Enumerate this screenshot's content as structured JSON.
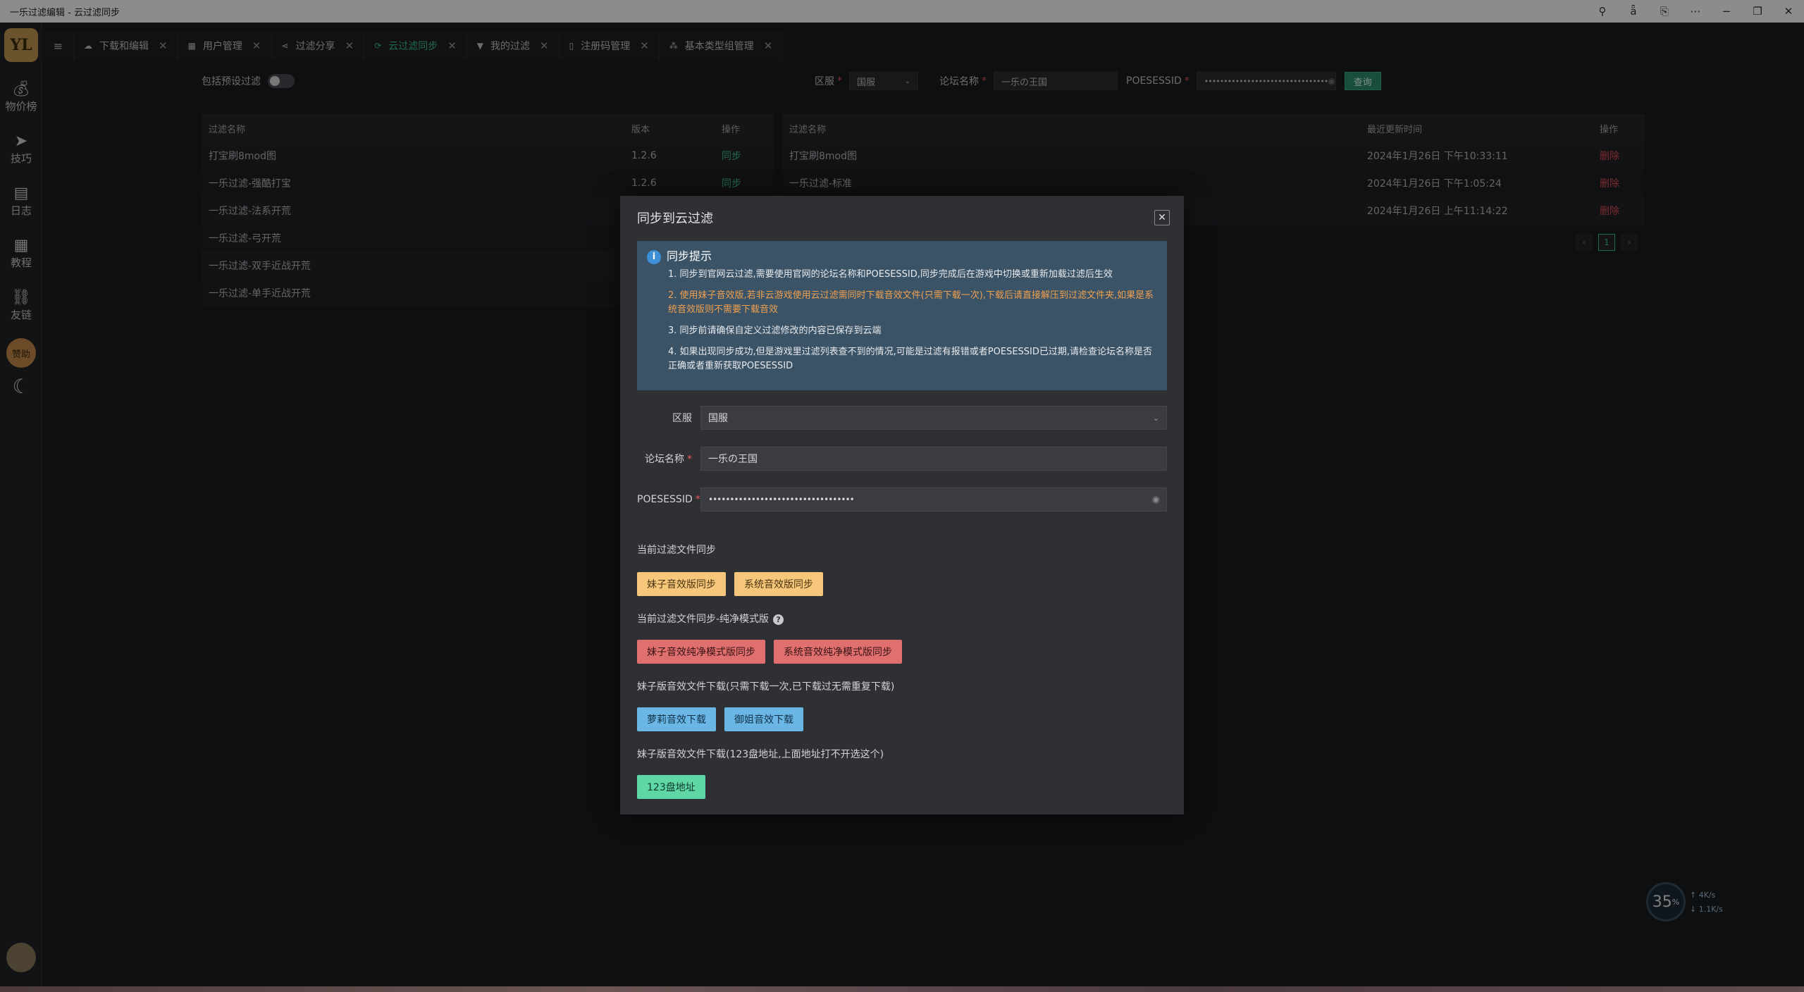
{
  "window": {
    "title": "一乐过滤编辑 - 云过滤同步"
  },
  "sidebar": {
    "logo": "YL",
    "items": [
      {
        "label": "物价榜",
        "icon": "money-bag-icon"
      },
      {
        "label": "技巧",
        "icon": "send-icon"
      },
      {
        "label": "日志",
        "icon": "notebook-icon"
      },
      {
        "label": "教程",
        "icon": "document-icon"
      },
      {
        "label": "友链",
        "icon": "link-icon"
      }
    ],
    "sponsor": "赞助"
  },
  "tabs": [
    {
      "label": "下载和编辑",
      "icon": "cloud-icon",
      "active": false
    },
    {
      "label": "用户管理",
      "icon": "grid-icon",
      "active": false
    },
    {
      "label": "过滤分享",
      "icon": "share-icon",
      "active": false
    },
    {
      "label": "云过滤同步",
      "icon": "sync-icon",
      "active": true
    },
    {
      "label": "我的过滤",
      "icon": "filter-icon",
      "active": false
    },
    {
      "label": "注册码管理",
      "icon": "card-icon",
      "active": false
    },
    {
      "label": "基本类型组管理",
      "icon": "cluster-icon",
      "active": false
    }
  ],
  "filters": {
    "include_preset": "包括预设过滤",
    "region_label": "区服",
    "region_value": "国服",
    "forum_label": "论坛名称",
    "forum_value": "一乐の王国",
    "sessid_label": "POESESSID",
    "sessid_value": "••••••••••••••••••••••••••••••••",
    "query": "查询"
  },
  "left_table": {
    "headers": [
      "过滤名称",
      "版本",
      "操作"
    ],
    "rows": [
      {
        "name": "打宝刷8mod图",
        "version": "1.2.6",
        "action": "同步"
      },
      {
        "name": "一乐过滤-强酷打宝",
        "version": "1.2.6",
        "action": "同步"
      },
      {
        "name": "一乐过滤-法系开荒",
        "version": "",
        "action": ""
      },
      {
        "name": "一乐过滤-弓开荒",
        "version": "",
        "action": ""
      },
      {
        "name": "一乐过滤-双手近战开荒",
        "version": "",
        "action": ""
      },
      {
        "name": "一乐过滤-单手近战开荒",
        "version": "",
        "action": ""
      }
    ]
  },
  "right_table": {
    "headers": [
      "过滤名称",
      "最近更新时间",
      "操作"
    ],
    "rows": [
      {
        "name": "打宝刷8mod图",
        "time": "2024年1月26日 下午10:33:11",
        "action": "删除"
      },
      {
        "name": "一乐过滤-标准",
        "time": "2024年1月26日 下午1:05:24",
        "action": "删除"
      },
      {
        "name": "",
        "time": "2024年1月26日 上午11:14:22",
        "action": "删除"
      }
    ],
    "page": "1"
  },
  "modal": {
    "title": "同步到云过滤",
    "tip_title": "同步提示",
    "tips": [
      "1. 同步到官网云过滤,需要使用官网的论坛名称和POESESSID,同步完成后在游戏中切换或重新加载过滤后生效",
      "2. 使用妹子音效版,若非云游戏使用云过滤需同时下载音效文件(只需下载一次),下载后请直接解压到过滤文件夹,如果是系统音效版则不需要下载音效",
      "3. 同步前请确保自定义过滤修改的内容已保存到云端",
      "4. 如果出现同步成功,但是游戏里过滤列表查不到的情况,可能是过滤有报错或者POESESSID已过期,请检查论坛名称是否正确或者重新获取POESESSID"
    ],
    "region_label": "区服",
    "region_value": "国服",
    "forum_label": "论坛名称",
    "forum_value": "一乐の王国",
    "sessid_label": "POESESSID",
    "sessid_value": "••••••••••••••••••••••••••••••••••",
    "sec1": "当前过滤文件同步",
    "btn_girl": "妹子音效版同步",
    "btn_sys": "系统音效版同步",
    "sec2": "当前过滤文件同步-纯净模式版",
    "btn_girl_pure": "妹子音效纯净模式版同步",
    "btn_sys_pure": "系统音效纯净模式版同步",
    "sec3": "妹子版音效文件下载(只需下载一次,已下载过无需重复下载)",
    "btn_loli": "萝莉音效下载",
    "btn_sister": "御姐音效下载",
    "sec4": "妹子版音效文件下载(123盘地址,上面地址打不开选这个)",
    "btn_123": "123盘地址"
  },
  "monitor": {
    "percent": "35",
    "unit": "%",
    "up": "4K/s",
    "down": "1.1K/s"
  }
}
